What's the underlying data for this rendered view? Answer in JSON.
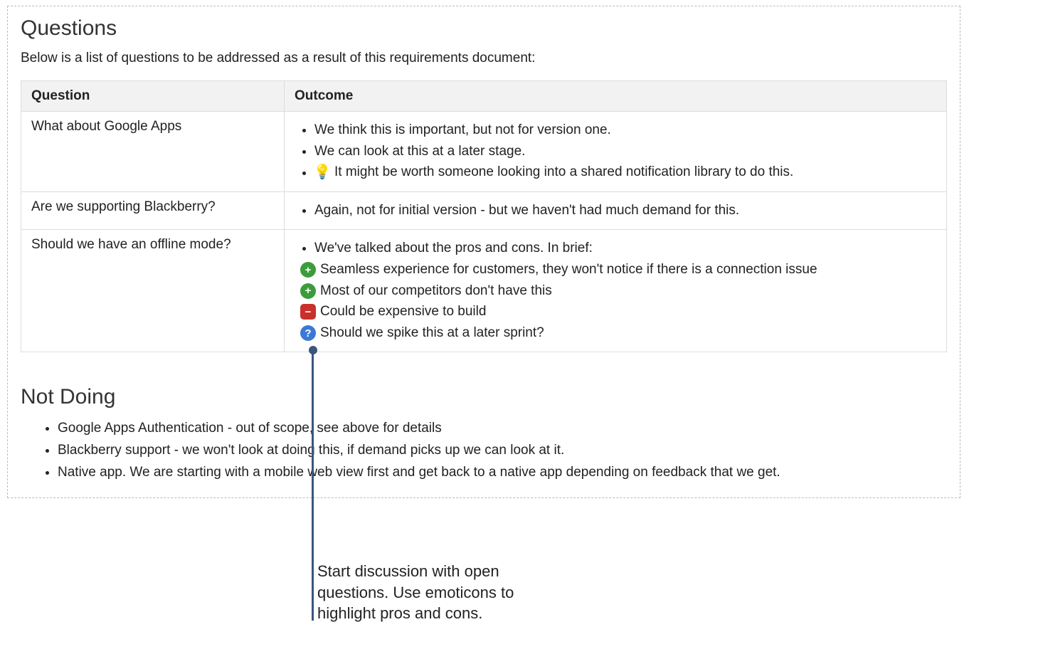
{
  "questions": {
    "heading": "Questions",
    "intro": "Below is a list of questions to be addressed as a result of this requirements document:",
    "headers": {
      "question": "Question",
      "outcome": "Outcome"
    },
    "rows": [
      {
        "question": "What about Google Apps",
        "outcome": [
          {
            "icon": null,
            "text": "We think this is important, but not for version one."
          },
          {
            "icon": null,
            "text": "We can look at this at a later stage."
          },
          {
            "icon": "bulb",
            "text": "It might be worth someone looking into a shared notification library to do this."
          }
        ]
      },
      {
        "question": "Are we supporting Blackberry?",
        "outcome": [
          {
            "icon": null,
            "text": "Again, not for initial version - but we haven't had much demand for this."
          }
        ]
      },
      {
        "question": "Should we have an offline mode?",
        "outcome": [
          {
            "icon": null,
            "text": "We've talked about the pros and cons. In brief:"
          },
          {
            "icon": "plus",
            "text": "Seamless experience for customers, they won't notice if there is a connection issue"
          },
          {
            "icon": "plus",
            "text": "Most of our competitors don't have this"
          },
          {
            "icon": "minus",
            "text": "Could be expensive to build"
          },
          {
            "icon": "quest",
            "text": "Should we spike this at a later sprint?"
          }
        ]
      }
    ]
  },
  "not_doing": {
    "heading": "Not Doing",
    "items": [
      "Google Apps Authentication - out of scope, see above for details",
      "Blackberry support - we won't look at doing this, if demand picks up we can look at it.",
      "Native app. We are starting with a mobile web view first and get back to a native app depending on feedback that we get."
    ]
  },
  "annotation": {
    "text": "Start discussion with open questions. Use emoticons to highlight pros and cons."
  },
  "icons": {
    "plus": "+",
    "minus": "−",
    "quest": "?",
    "bulb": "💡"
  }
}
